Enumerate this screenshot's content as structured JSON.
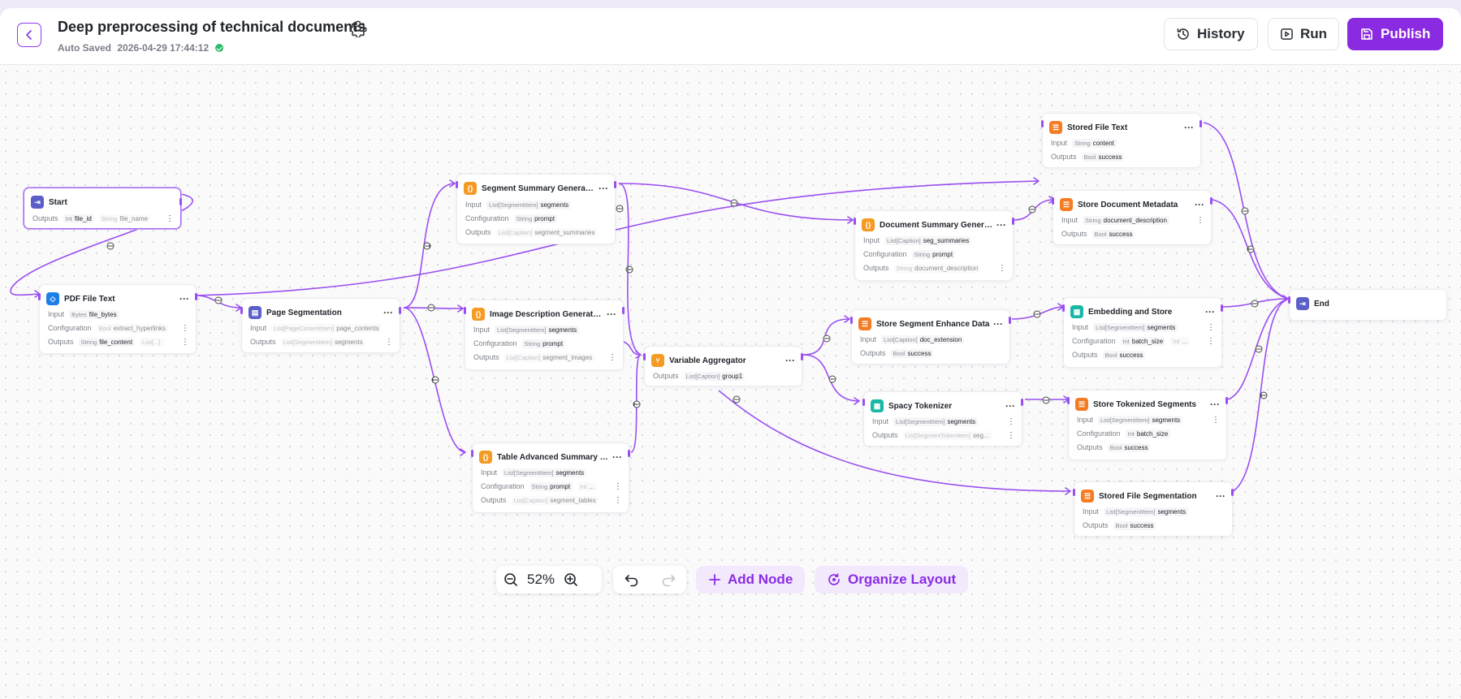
{
  "header": {
    "title": "Deep preprocessing of technical documents",
    "autosave_label": "Auto Saved",
    "autosave_time": "2026-04-29 17:44:12",
    "buttons": {
      "history": "History",
      "run": "Run",
      "publish": "Publish"
    }
  },
  "colors": {
    "accent": "#8a2be2",
    "edge": "#9a4ff0",
    "success": "#2ebd6b"
  },
  "nodes": {
    "start": {
      "title": "Start",
      "icon": "start-icon",
      "outputs_label": "Outputs",
      "outputs": [
        [
          "Int",
          "file_id"
        ],
        [
          "String",
          "file_name"
        ]
      ]
    },
    "pdf": {
      "title": "PDF File Text",
      "icon": "pdf-icon",
      "input_label": "Input",
      "input": [
        [
          "Bytes",
          "file_bytes"
        ]
      ],
      "config_label": "Configuration",
      "config": [
        [
          "Bool",
          "extract_hyperlinks"
        ]
      ],
      "outputs_label": "Outputs",
      "outputs": [
        [
          "String",
          "file_content"
        ],
        [
          "List[...]",
          ""
        ]
      ]
    },
    "pageseg": {
      "title": "Page Segmentation",
      "icon": "segmentation-icon",
      "input_label": "Input",
      "input": [
        [
          "List[PageContentItem]",
          "page_contents"
        ]
      ],
      "outputs_label": "Outputs",
      "outputs": [
        [
          "List[SegmentItem]",
          "segments"
        ]
      ]
    },
    "segsum": {
      "title": "Segment Summary Generation",
      "icon": "llm-icon",
      "input_label": "Input",
      "input": [
        [
          "List[SegmentItem]",
          "segments"
        ]
      ],
      "config_label": "Configuration",
      "config": [
        [
          "String",
          "prompt"
        ]
      ],
      "outputs_label": "Outputs",
      "outputs": [
        [
          "List[Caption]",
          "segment_summaries"
        ]
      ]
    },
    "imgdesc": {
      "title": "Image Description Generation",
      "icon": "llm-icon",
      "input_label": "Input",
      "input": [
        [
          "List[SegmentItem]",
          "segments"
        ]
      ],
      "config_label": "Configuration",
      "config": [
        [
          "String",
          "prompt"
        ]
      ],
      "outputs_label": "Outputs",
      "outputs": [
        [
          "List[Caption]",
          "segment_images"
        ]
      ]
    },
    "tablesum": {
      "title": "Table Advanced Summary Gen...",
      "icon": "llm-icon",
      "input_label": "Input",
      "input": [
        [
          "List[SegmentItem]",
          "segments"
        ]
      ],
      "config_label": "Configuration",
      "config": [
        [
          "String",
          "prompt"
        ],
        [
          "Int",
          "..."
        ]
      ],
      "outputs_label": "Outputs",
      "outputs": [
        [
          "List[Caption]",
          "segment_tables"
        ]
      ]
    },
    "varagg": {
      "title": "Variable Aggregator",
      "icon": "aggregator-icon",
      "outputs_label": "Outputs",
      "outputs": [
        [
          "List[Caption]",
          "group1"
        ]
      ]
    },
    "docsum": {
      "title": "Document Summary Generation",
      "icon": "llm-icon",
      "input_label": "Input",
      "input": [
        [
          "List[Caption]",
          "seg_summaries"
        ]
      ],
      "config_label": "Configuration",
      "config": [
        [
          "String",
          "prompt"
        ]
      ],
      "outputs_label": "Outputs",
      "outputs": [
        [
          "String",
          "document_description"
        ]
      ]
    },
    "storefile": {
      "title": "Stored File Text",
      "icon": "database-icon",
      "input_label": "Input",
      "input": [
        [
          "String",
          "content"
        ]
      ],
      "outputs_label": "Outputs",
      "outputs": [
        [
          "Bool",
          "success"
        ]
      ]
    },
    "storemeta": {
      "title": "Store Document Metadata",
      "icon": "database-icon",
      "input_label": "Input",
      "input": [
        [
          "String",
          "document_description"
        ]
      ],
      "outputs_label": "Outputs",
      "outputs": [
        [
          "Bool",
          "success"
        ]
      ]
    },
    "storeenh": {
      "title": "Store Segment Enhance Data",
      "icon": "database-icon",
      "input_label": "Input",
      "input": [
        [
          "List[Caption]",
          "doc_extension"
        ]
      ],
      "outputs_label": "Outputs",
      "outputs": [
        [
          "Bool",
          "success"
        ]
      ]
    },
    "embed": {
      "title": "Embedding and Store",
      "icon": "embedding-icon",
      "input_label": "Input",
      "input": [
        [
          "List[SegmentItem]",
          "segments"
        ]
      ],
      "config_label": "Configuration",
      "config": [
        [
          "Int",
          "batch_size"
        ],
        [
          "Int",
          "..."
        ]
      ],
      "outputs_label": "Outputs",
      "outputs": [
        [
          "Bool",
          "success"
        ]
      ]
    },
    "spacy": {
      "title": "Spacy Tokenizer",
      "icon": "tokenizer-icon",
      "input_label": "Input",
      "input": [
        [
          "List[SegmentItem]",
          "segments"
        ]
      ],
      "outputs_label": "Outputs",
      "outputs": [
        [
          "List[SegmentTokenItem]",
          "seg..."
        ]
      ]
    },
    "storetok": {
      "title": "Store Tokenized Segments",
      "icon": "database-icon",
      "input_label": "Input",
      "input": [
        [
          "List[SegmentItem]",
          "segments"
        ]
      ],
      "config_label": "Configuration",
      "config": [
        [
          "Int",
          "batch_size"
        ]
      ],
      "outputs_label": "Outputs",
      "outputs": [
        [
          "Bool",
          "success"
        ]
      ]
    },
    "storeseg": {
      "title": "Stored File Segmentation",
      "icon": "database-icon",
      "input_label": "Input",
      "input": [
        [
          "List[SegmentItem]",
          "segments"
        ]
      ],
      "outputs_label": "Outputs",
      "outputs": [
        [
          "Bool",
          "success"
        ]
      ]
    },
    "end": {
      "title": "End",
      "icon": "end-icon"
    }
  },
  "toolbar": {
    "zoom": "52%",
    "add_node": "Add Node",
    "organize_layout": "Organize Layout"
  }
}
